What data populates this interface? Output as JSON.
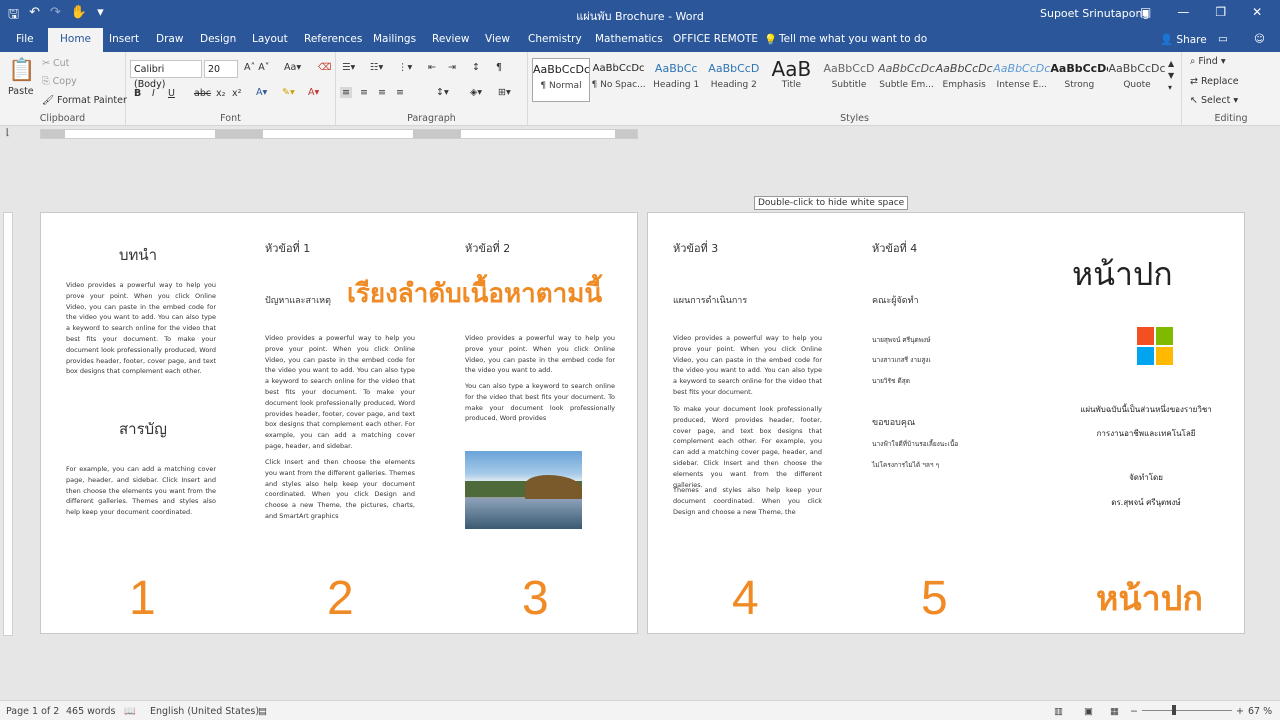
{
  "titlebar": {
    "title": "แผ่นพับ Brochure - Word",
    "user": "Supoet Srinutapong",
    "icons": [
      "save-icon",
      "undo-icon",
      "redo-icon",
      "touch-mode-icon",
      "customize-icon"
    ]
  },
  "tabs": [
    "File",
    "Home",
    "Insert",
    "Draw",
    "Design",
    "Layout",
    "References",
    "Mailings",
    "Review",
    "View",
    "Chemistry",
    "Mathematics",
    "OFFICE REMOTE"
  ],
  "tell_me": "Tell me what you want to do",
  "share": "Share",
  "ribbon": {
    "clipboard": {
      "paste": "Paste",
      "cut": "Cut",
      "copy": "Copy",
      "format_painter": "Format Painter",
      "label": "Clipboard"
    },
    "font": {
      "name": "Calibri (Body)",
      "size": "20",
      "label": "Font",
      "bold": "B",
      "italic": "I",
      "underline": "U",
      "strike": "abc",
      "sub": "x₂",
      "sup": "x²"
    },
    "paragraph": {
      "label": "Paragraph"
    },
    "styles": {
      "label": "Styles",
      "items": [
        {
          "preview": "AaBbCcDc",
          "name": "¶ Normal"
        },
        {
          "preview": "AaBbCcDc",
          "name": "¶ No Spac..."
        },
        {
          "preview": "AaBbCc",
          "name": "Heading 1"
        },
        {
          "preview": "AaBbCcD",
          "name": "Heading 2"
        },
        {
          "preview": "AaB",
          "name": "Title"
        },
        {
          "preview": "AaBbCcD",
          "name": "Subtitle"
        },
        {
          "preview": "AaBbCcDc",
          "name": "Subtle Em..."
        },
        {
          "preview": "AaBbCcDc",
          "name": "Emphasis"
        },
        {
          "preview": "AaBbCcDc",
          "name": "Intense E..."
        },
        {
          "preview": "AaBbCcDc",
          "name": "Strong"
        },
        {
          "preview": "AaBbCcDc",
          "name": "Quote"
        }
      ]
    },
    "editing": {
      "find": "Find",
      "replace": "Replace",
      "select": "Select",
      "label": "Editing"
    }
  },
  "tooltip": "Double-click to hide white space",
  "page1": {
    "col1_heading": "บทนำ",
    "col1_body": "Video provides a powerful way to help you prove your point. When you click Online Video, you can paste in the embed code for the video you want to add. You can also type a keyword to search online for the video that best fits your document. To make your document look professionally produced, Word provides header, footer, cover page, and text box designs that complement each other.",
    "col1_heading2": "สารบัญ",
    "col1_body2": "For example, you can add a matching cover page, header, and sidebar. Click Insert and then choose the elements you want from the different galleries. Themes and styles also help keep your document coordinated.",
    "col2_heading": "หัวข้อที่ 1",
    "col2_sub": "ปัญหาและสาเหตุ",
    "col2_body": "Video provides a powerful way to help you prove your point. When you click Online Video, you can paste in the embed code for the video you want to add. You can also type a keyword to search online for the video that best fits your document. To make your document look professionally produced, Word provides header, footer, cover page, and text box designs that complement each other. For example, you can add a matching cover page, header, and sidebar.",
    "col2_body2": "Click Insert and then choose the elements you want from the different galleries. Themes and styles also help keep your document coordinated. When you click Design and choose a new Theme, the pictures, charts, and SmartArt graphics",
    "col3_heading": "หัวข้อที่ 2",
    "col3_body": "Video provides a powerful way to help you prove your point. When you click Online Video, you can paste in the embed code for the video you want to add.",
    "col3_body2": "You can also type a keyword to search online for the video that best fits your document. To make your document look professionally produced, Word provides",
    "overlay": "เรียงลำดับเนื้อหาตามนี้",
    "numbers": [
      "1",
      "2",
      "3"
    ]
  },
  "page2": {
    "col1_heading": "หัวข้อที่ 3",
    "col1_sub": "แผนการดำเนินการ",
    "col1_body": "Video provides a powerful way to help you prove your point. When you click Online Video, you can paste in the embed code for the video you want to add. You can also type a keyword to search online for the video that best fits your document.",
    "col1_body2": "To make your document look professionally produced, Word provides header, footer, cover page, and text box designs that complement each other. For example, you can add a matching cover page, header, and sidebar. Click Insert and then choose the elements you want from the different galleries.",
    "col1_body3": "Themes and styles also help keep your document coordinated. When you click Design and choose a new Theme, the",
    "col2_heading": "หัวข้อที่ 4",
    "col2_sub": "คณะผู้จัดทำ",
    "members": [
      "นายสุพจน์ ศรีนุตพงษ์",
      "นางสาวเกสรี งามสูงเ",
      "นายวิรัช ดีสุด"
    ],
    "col2_sub2": "ขอขอบคุณ",
    "thanks": [
      "นางฟ้าใจดีที่บ้านรอเลี้ยงนะเนื้อ",
      "ไม่โครงการไม่ได้ ฯลฯ ๆ"
    ],
    "cover_title": "หน้าปก",
    "cover_line1": "แผ่นพับฉบับนี้เป็นส่วนหนึ่งของรายวิชา",
    "cover_line2": "การงานอาชีพและเทคโนโลยี",
    "cover_by": "จัดทำโดย",
    "cover_author": "ดร.สุพจน์ ศรีนุตพงษ์",
    "numbers": [
      "4",
      "5"
    ],
    "cover_overlay": "หน้าปก"
  },
  "status": {
    "page": "Page 1 of 2",
    "words": "465 words",
    "language": "English (United States)",
    "zoom": "67 %"
  }
}
